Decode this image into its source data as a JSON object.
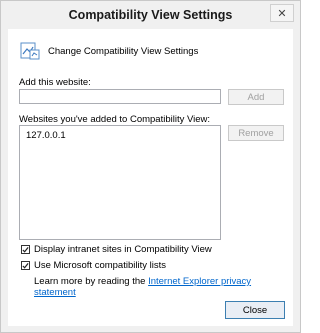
{
  "window": {
    "title": "Compatibility View Settings",
    "close_glyph": "✕"
  },
  "header": {
    "icon": "compat-view-icon",
    "text": "Change Compatibility View Settings"
  },
  "add_site": {
    "label": "Add this website:",
    "value": "",
    "placeholder": "",
    "add_button": "Add"
  },
  "sites": {
    "label": "Websites you've added to Compatibility View:",
    "items": [
      "127.0.0.1"
    ],
    "remove_button": "Remove"
  },
  "options": {
    "intranet": {
      "label": "Display intranet sites in Compatibility View",
      "checked": true
    },
    "ms_lists": {
      "label": "Use Microsoft compatibility lists",
      "checked": true
    }
  },
  "learn_more": {
    "prefix": "Learn more by reading the ",
    "link": "Internet Explorer privacy statement"
  },
  "footer": {
    "close_button": "Close"
  }
}
